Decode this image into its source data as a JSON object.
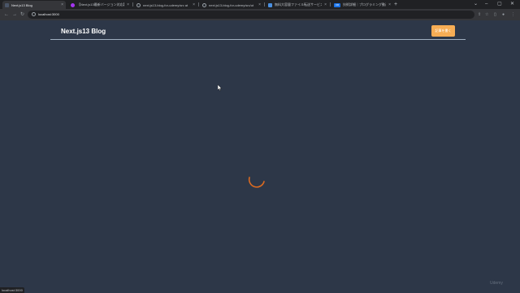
{
  "browser": {
    "tabs": [
      {
        "title": "Next.js13 Blog",
        "active": true,
        "favicon_color": "#4a5568"
      },
      {
        "title": "【Next.js13最新バージョン対応】Next.js",
        "active": false,
        "favicon_color": "#a435f0"
      },
      {
        "title": "next.js13-blog-for-udemy/src at",
        "active": false,
        "favicon_color": "#24292f"
      },
      {
        "title": "next.js13-blog-for-udemy/src/ut",
        "active": false,
        "favicon_color": "#24292f"
      },
      {
        "title": "無料大容量ファイル転送サービス Gi",
        "active": false,
        "favicon_color": "#4a90e2"
      },
      {
        "title": "技術詳細｜プログラミング動画カテゴリ",
        "active": false,
        "favicon_color": "#1a73e8",
        "favicon_text": "CR"
      }
    ],
    "new_tab_label": "+",
    "url": "localhost:3000",
    "status_url": "localhost:3000"
  },
  "page": {
    "brand": "Next.js13 Blog",
    "new_article_button": "記事を書く",
    "watermark": "Udemy"
  },
  "colors": {
    "page_background": "#2d3748",
    "accent": "#f6ad55",
    "divider": "#a0aec0"
  }
}
